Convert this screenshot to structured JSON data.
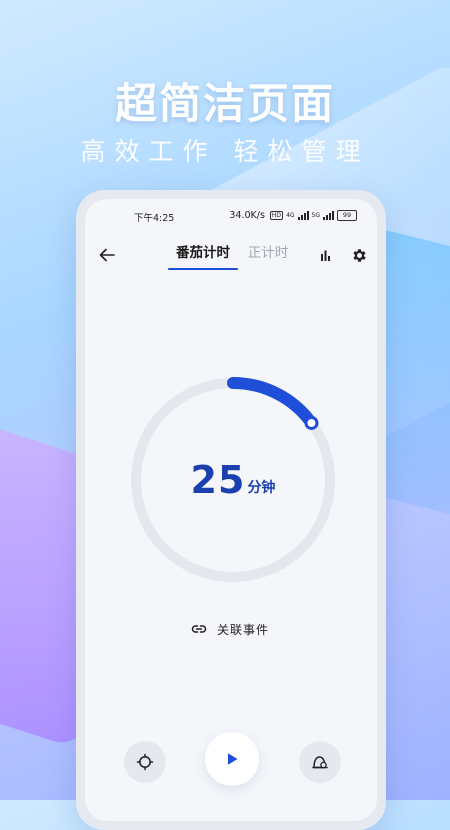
{
  "promo": {
    "headline": "超简洁页面",
    "subline": "高效工作  轻松管理"
  },
  "status_bar": {
    "time": "下午4:25",
    "net_speed": "34.0K/s",
    "hd_tag": "HD",
    "network_4g": "4G",
    "network_5g": "5G",
    "battery": "99"
  },
  "nav": {
    "back_icon": "arrow-left-icon",
    "tabs": [
      {
        "label": "番茄计时",
        "active": true
      },
      {
        "label": "正计时",
        "active": false
      }
    ],
    "stats_icon": "bar-chart-icon",
    "settings_icon": "gear-icon"
  },
  "timer": {
    "value": "25",
    "unit": "分钟",
    "progress_fraction": 0.15
  },
  "link_event": {
    "icon": "link-icon",
    "label": "关联事件"
  },
  "controls": {
    "left_icon": "crosshair-icon",
    "center_icon": "play-icon",
    "right_icon": "mode-icon"
  },
  "colors": {
    "accent": "#1f4ed8",
    "timer_text": "#1b3fae",
    "ring_track": "#e3e7ee",
    "inactive_tab": "#a3a8b2"
  }
}
